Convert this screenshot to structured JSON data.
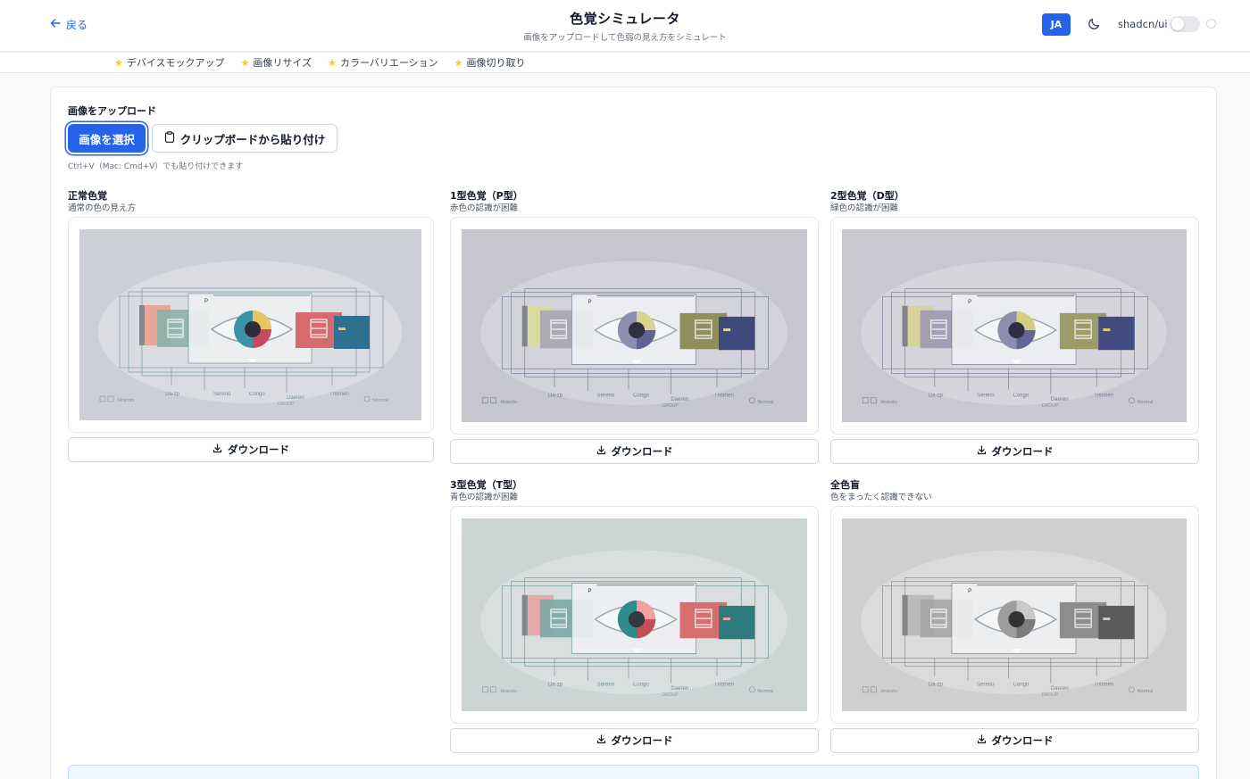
{
  "header": {
    "back_label": "戻る",
    "title": "色覚シミュレータ",
    "subtitle": "画像をアップロードして色弱の見え方をシミュレート",
    "lang_label": "JA",
    "library_label": "shadcn/ui",
    "toggle_on": false
  },
  "tools": [
    {
      "label": "デバイスモックアップ",
      "icon": "star-icon"
    },
    {
      "label": "画像リサイズ",
      "icon": "star-icon"
    },
    {
      "label": "カラーバリエーション",
      "icon": "star-icon"
    },
    {
      "label": "画像切り取り",
      "icon": "star-icon"
    }
  ],
  "upload": {
    "label": "画像をアップロード",
    "select_label": "画像を選択",
    "paste_label": "クリップボードから貼り付け",
    "hint": "Ctrl+V（Mac: Cmd+V）でも貼り付けできます"
  },
  "image_labels": {
    "row_labels": [
      "Da-zp",
      "Sereno",
      "Congo",
      "Daeren",
      "Triomen"
    ],
    "group": "GROUP",
    "normal": "Normal",
    "left_small": "Hraroto",
    "p": "P"
  },
  "simulations": [
    {
      "title": "正常色覚",
      "desc": "通常の色の見え方",
      "download": "ダウンロード",
      "palette": {
        "bg": "#ccd0d6",
        "inner": "#e2e5e9",
        "c1": "#e9a598",
        "c2": "#8bb2a9",
        "c3": "#d66b6f",
        "c4": "#2f6f8f",
        "iris1": "#e7c65f",
        "iris2": "#c64a5f",
        "iris3": "#3a93a8",
        "pupil": "#2f2b3a",
        "accent": "#5b7c8b"
      }
    },
    {
      "title": "1型色覚（P型）",
      "desc": "赤色の認識が困難",
      "download": "ダウンロード",
      "palette": {
        "bg": "#c6c6cf",
        "inner": "#dcdce2",
        "c1": "#dadba3",
        "c2": "#a5a5b3",
        "c3": "#8f8f5e",
        "c4": "#3e4a7c",
        "iris1": "#d8d68c",
        "iris2": "#5f6293",
        "iris3": "#8c8fb0",
        "pupil": "#2f2f44",
        "accent": "#5b6082"
      }
    },
    {
      "title": "2型色覚（D型）",
      "desc": "緑色の認識が困難",
      "download": "ダウンロード",
      "palette": {
        "bg": "#c9c8d0",
        "inner": "#dfdee3",
        "c1": "#d8d39c",
        "c2": "#9c9ab1",
        "c3": "#9c9b6a",
        "c4": "#414b7f",
        "iris1": "#d3cf82",
        "iris2": "#636593",
        "iris3": "#8d8eae",
        "pupil": "#2f2f44",
        "accent": "#5d6083"
      }
    },
    {
      "title": "3型色覚（T型）",
      "desc": "青色の認識が困難",
      "download": "ダウンロード",
      "palette": {
        "bg": "#cdd5d4",
        "inner": "#e1e6e5",
        "c1": "#e4a9a8",
        "c2": "#7aa9a5",
        "c3": "#d66e70",
        "c4": "#2f7a7c",
        "iris1": "#f2a0a2",
        "iris2": "#c84d5a",
        "iris3": "#2f8a88",
        "pupil": "#2f3b3e",
        "accent": "#4f7d7f"
      }
    },
    {
      "title": "全色盲",
      "desc": "色をまったく認識できない",
      "download": "ダウンロード",
      "palette": {
        "bg": "#cfcfcf",
        "inner": "#e3e3e3",
        "c1": "#bcbcbc",
        "c2": "#a5a5a5",
        "c3": "#8d8d8d",
        "c4": "#5a5a5a",
        "iris1": "#c9c9c9",
        "iris2": "#7c7c7c",
        "iris3": "#9e9e9e",
        "pupil": "#333333",
        "accent": "#6e6e6e"
      }
    }
  ]
}
